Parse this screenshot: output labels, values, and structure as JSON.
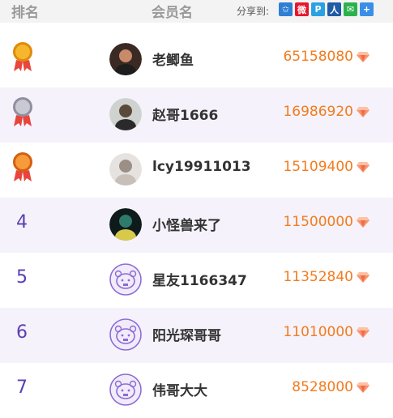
{
  "header": {
    "rank_label": "排名",
    "member_label": "会员名",
    "share_label": "分享到:",
    "share_icons": [
      {
        "name": "qzone-icon",
        "glyph": "✩",
        "color": "#2f7fd3"
      },
      {
        "name": "weibo-icon",
        "glyph": "微",
        "color": "#e6162d"
      },
      {
        "name": "tqq-icon",
        "glyph": "P",
        "color": "#2aa1e3"
      },
      {
        "name": "renren-icon",
        "glyph": "人",
        "color": "#1f5ba7"
      },
      {
        "name": "wechat-icon",
        "glyph": "✉",
        "color": "#2bb24c"
      },
      {
        "name": "more-icon",
        "glyph": "+",
        "color": "#3a8ee6"
      }
    ]
  },
  "rows": [
    {
      "rank": "1",
      "medal": "gold",
      "name": "老鲫鱼",
      "score": "65158080",
      "avatar": "photo-dark"
    },
    {
      "rank": "2",
      "medal": "silver",
      "name": "赵哥1666",
      "score": "16986920",
      "avatar": "photo-man"
    },
    {
      "rank": "3",
      "medal": "bronze",
      "name": "lcy19911013",
      "score": "15109400",
      "avatar": "photo-light"
    },
    {
      "rank": "4",
      "medal": "",
      "name": "小怪兽来了",
      "score": "11500000",
      "avatar": "photo-peacock"
    },
    {
      "rank": "5",
      "medal": "",
      "name": "星友1166347",
      "score": "11352840",
      "avatar": "default"
    },
    {
      "rank": "6",
      "medal": "",
      "name": "阳光琛哥哥",
      "score": "11010000",
      "avatar": "default"
    },
    {
      "rank": "7",
      "medal": "",
      "name": "伟哥大大",
      "score": "8528000",
      "avatar": "default"
    }
  ],
  "colors": {
    "accent": "#5b3fb3",
    "score": "#f27b1d",
    "alt_row": "#f5f2fb"
  }
}
